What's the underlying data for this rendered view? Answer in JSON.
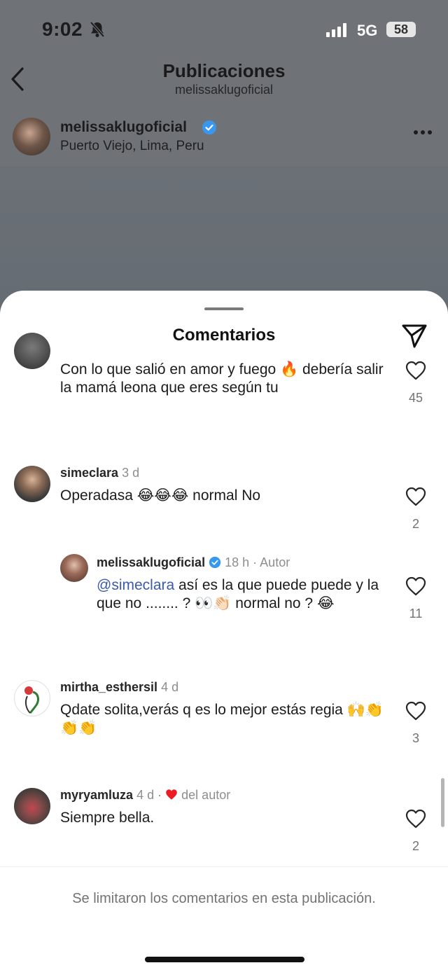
{
  "status_bar": {
    "time": "9:02",
    "network": "5G",
    "battery": "58"
  },
  "nav": {
    "title": "Publicaciones",
    "subtitle": "melissaklugoficial"
  },
  "post": {
    "username": "melissaklugoficial",
    "location": "Puerto Viejo, Lima, Peru"
  },
  "sheet": {
    "title": "Comentarios",
    "comments": [
      {
        "text": "Con lo que salió en amor y fuego 🔥 debería salir la mamá leona que eres según tu",
        "likes": "45"
      },
      {
        "username": "simeclara",
        "time": "3 d",
        "text": "Operadasa 😂😂😂 normal No",
        "likes": "2"
      },
      {
        "username": "melissaklugoficial",
        "time": "18 h",
        "tag": "· Autor",
        "mention": "@simeclara",
        "text": " así es la que puede puede y la que no ........ ? 👀👏🏻 normal no ? 😂",
        "likes": "11"
      },
      {
        "username": "mirtha_esthersil",
        "time": "4 d",
        "text": "Qdate solita,verás q es lo mejor estás regia 🙌👏👏👏",
        "likes": "3"
      },
      {
        "username": "myryamluza",
        "time": "4 d",
        "separator": "·",
        "tag": "del autor",
        "text": "Siempre bella.",
        "likes": "2"
      }
    ],
    "footer_note": "Se limitaron los comentarios en esta publicación."
  },
  "colors": {
    "verified": "#3897f0",
    "heart_red": "#ed1c24",
    "mention": "#3b5ba9"
  }
}
